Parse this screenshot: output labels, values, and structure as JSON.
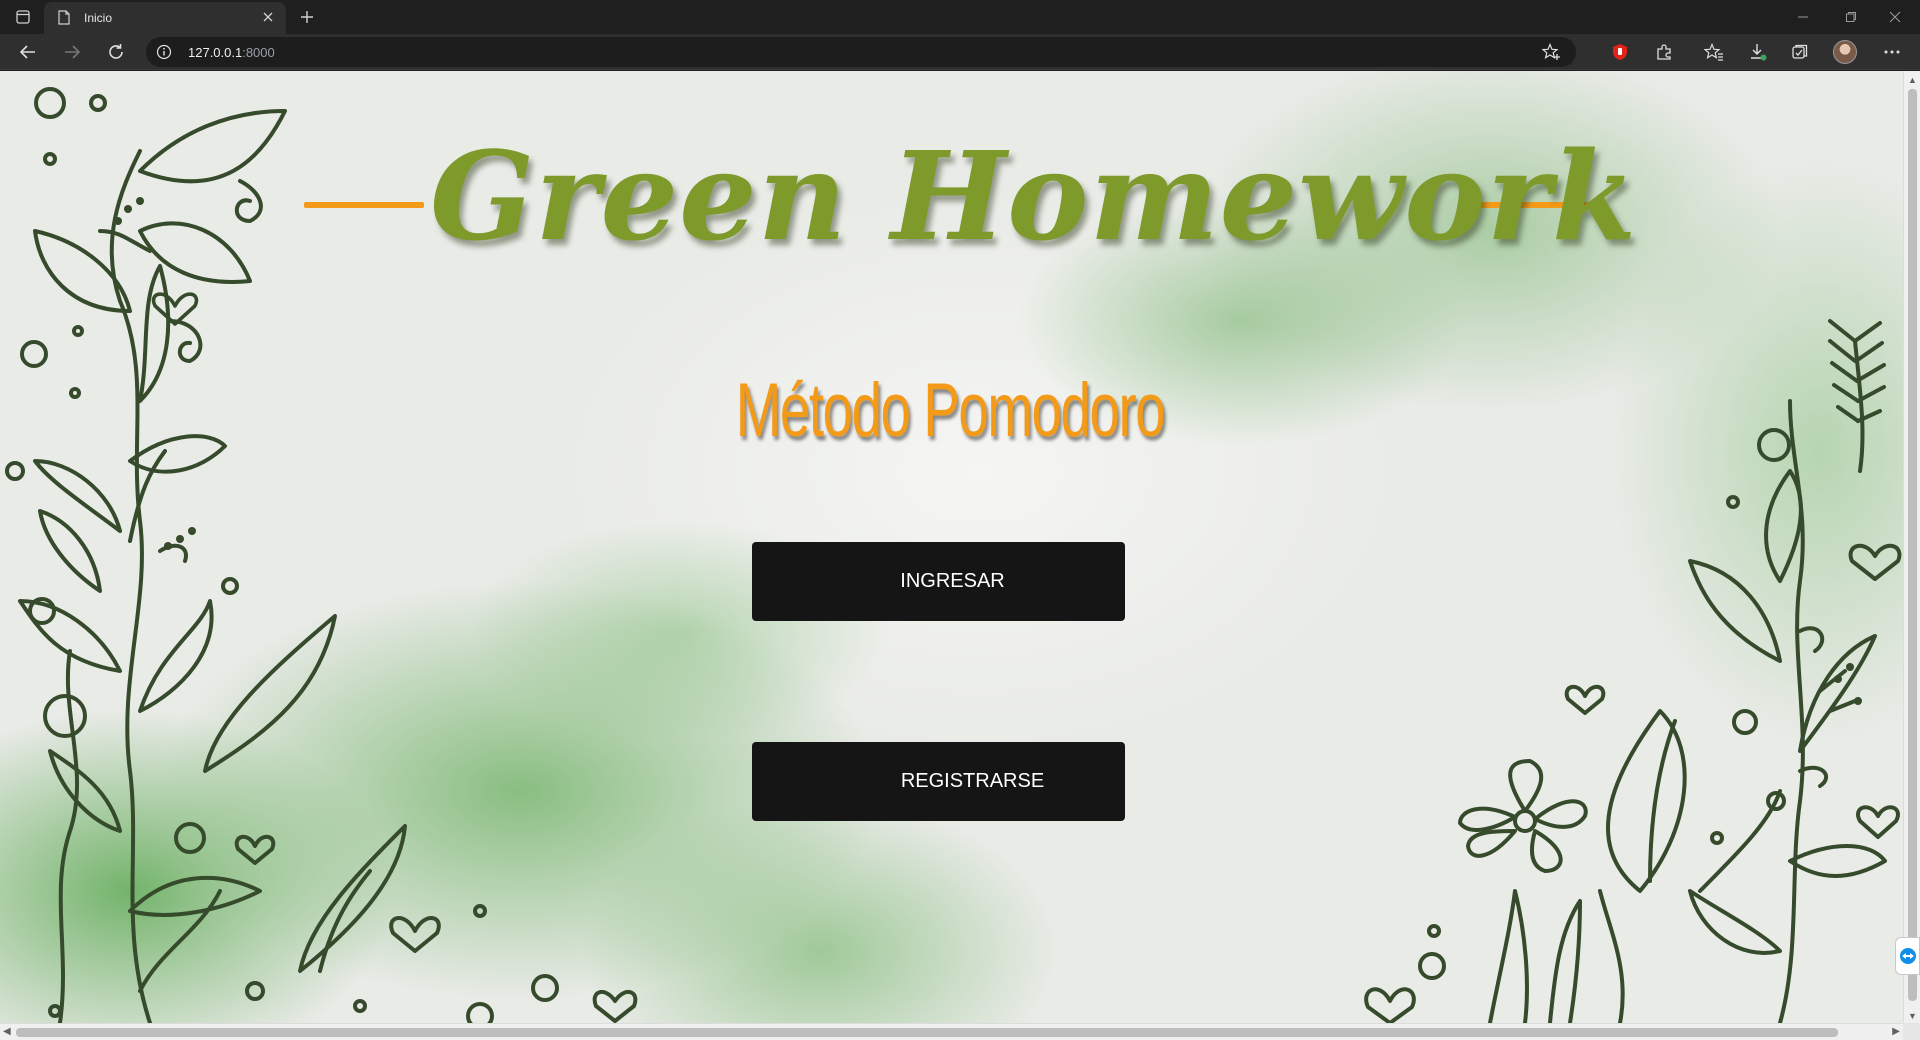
{
  "browser": {
    "tab_title": "Inicio",
    "url_host": "127.0.0.1",
    "url_port": ":8000"
  },
  "page": {
    "title": "Green Homework",
    "subtitle": "Método Pomodoro",
    "buttons": {
      "login": "INGRESAR",
      "register": "REGISTRARSE"
    }
  },
  "colors": {
    "title_green": "#7e9a2b",
    "subtitle_orange": "#f39a19",
    "button_bg": "#151515",
    "line_art": "#364a2c"
  },
  "icons": [
    "tab-actions-icon",
    "page-icon",
    "close-icon",
    "plus-icon",
    "back-icon",
    "forward-icon",
    "reload-icon",
    "info-icon",
    "star-add-icon",
    "shield-extension-icon",
    "puzzle-icon",
    "favorites-icon",
    "download-icon",
    "collections-icon",
    "more-icon",
    "teamviewer-icon"
  ]
}
